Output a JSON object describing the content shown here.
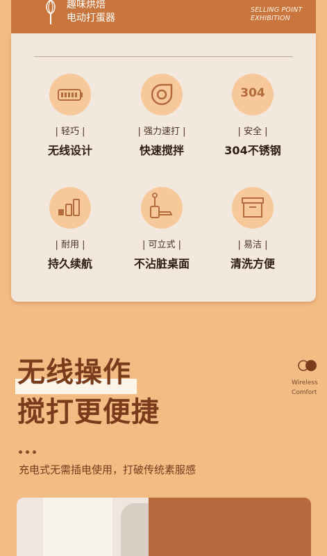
{
  "header": {
    "brand_line1": "趣味烘焙",
    "brand_line2": "电动打蛋器",
    "tag_line1": "SELLING POINT",
    "tag_line2": "EXHIBITION"
  },
  "features": [
    {
      "icon": "battery-icon",
      "tag": "| 轻巧 |",
      "title": "无线设计"
    },
    {
      "icon": "swirl-icon",
      "tag": "| 强力速打 |",
      "title": "快速搅拌"
    },
    {
      "icon": "304-badge-icon",
      "icon_text": "304",
      "tag": "| 安全 |",
      "title": "304不锈钢"
    },
    {
      "icon": "bar-chart-icon",
      "tag": "| 耐用 |",
      "title": "持久续航"
    },
    {
      "icon": "standing-mixer-icon",
      "tag": "| 可立式 |",
      "title": "不沾脏桌面"
    },
    {
      "icon": "box-icon",
      "tag": "| 易洁 |",
      "title": "清洗方便"
    }
  ],
  "section": {
    "headline1": "无线操作",
    "headline2": "搅打更便捷",
    "description": "充电式无需插电使用，打破传统素服感",
    "side_label1": "Wireless",
    "side_label2": "Comfort"
  },
  "colors": {
    "background": "#f2bd84",
    "header": "#c8763d",
    "card": "#f3e8de",
    "icon_circle": "#f7c99a",
    "icon_stroke": "#b36b3b",
    "headline": "#7a3b1c"
  }
}
